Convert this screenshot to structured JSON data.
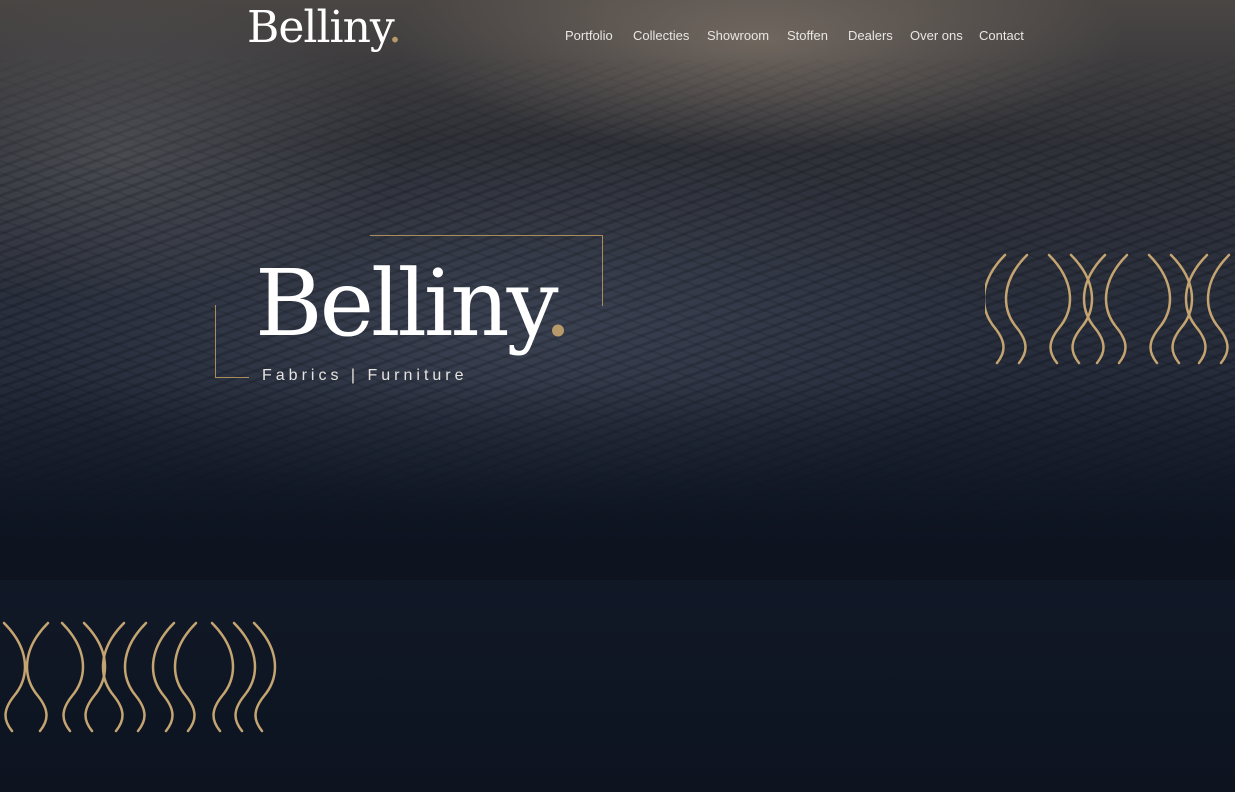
{
  "header": {
    "logo": "Belliny",
    "logo_dot": "."
  },
  "nav": {
    "items": [
      {
        "label": "Portfolio"
      },
      {
        "label": "Collecties"
      },
      {
        "label": "Showroom"
      },
      {
        "label": "Stoffen"
      },
      {
        "label": "Dealers"
      },
      {
        "label": "Over ons"
      },
      {
        "label": "Contact"
      }
    ]
  },
  "hero": {
    "logo": "Belliny",
    "logo_dot": ".",
    "tagline": "Fabrics | Furniture"
  },
  "colors": {
    "accent_gold": "#b89a6a",
    "background_navy": "#0d1420",
    "text_white": "#ffffff"
  },
  "decor": {
    "right_waves_icon": "gold-wave-pattern-icon",
    "left_waves_icon": "gold-wave-pattern-icon"
  }
}
